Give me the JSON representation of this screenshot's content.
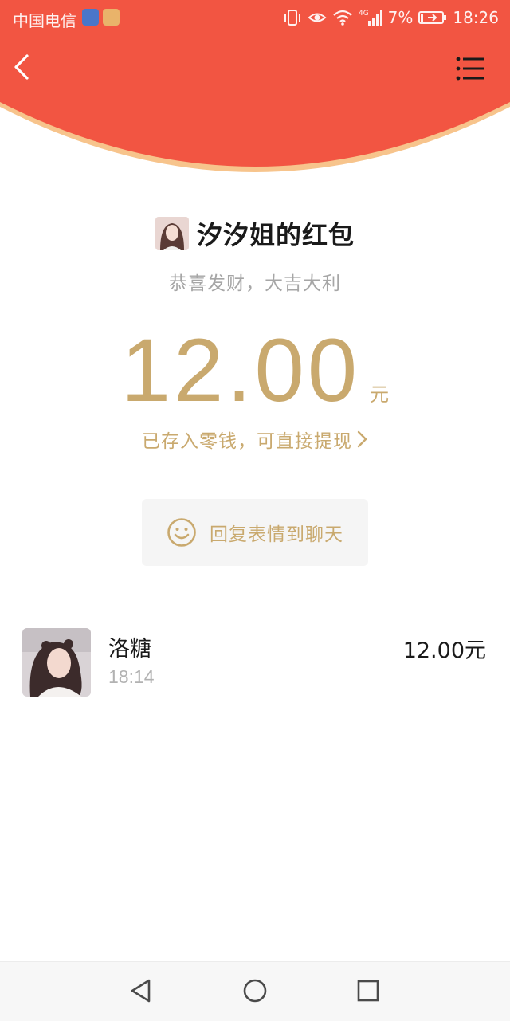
{
  "status_bar": {
    "carrier": "中国电信",
    "battery": "7%",
    "time": "18:26"
  },
  "header": {
    "color": "#f25542",
    "back_icon": "chevron-left-icon",
    "menu_icon": "list-menu-icon"
  },
  "packet": {
    "sender_title": "汐汐姐的红包",
    "greeting": "恭喜发财，大吉大利",
    "amount": "12.00",
    "unit": "元",
    "saved_text": "已存入零钱，可直接提现",
    "reply_label": "回复表情到聊天",
    "accent_color": "#c9a96e"
  },
  "receivers": [
    {
      "name": "洛糖",
      "time": "18:14",
      "amount": "12.00元"
    }
  ],
  "nav": {
    "back_icon": "triangle-back-icon",
    "home_icon": "circle-home-icon",
    "recent_icon": "square-recent-icon"
  }
}
